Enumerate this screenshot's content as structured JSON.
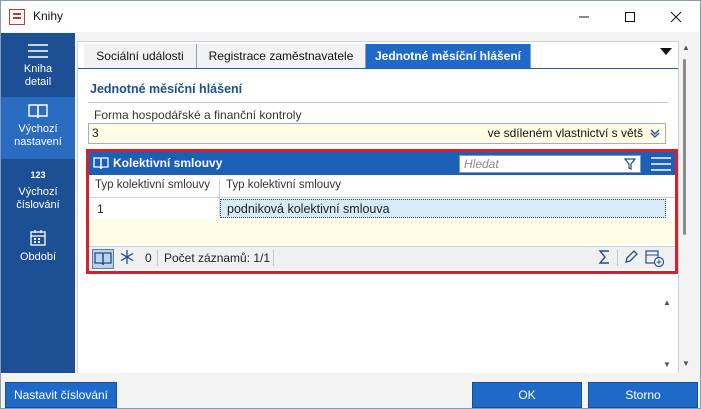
{
  "window": {
    "title": "Knihy",
    "controls": [
      "minimize",
      "maximize",
      "close"
    ]
  },
  "sidebar": {
    "items": [
      {
        "label1": "Kniha",
        "label2": "detail",
        "icon": "hamburger-icon"
      },
      {
        "label1": "Výchozí",
        "label2": "nastavení",
        "icon": "book-icon",
        "active": true
      },
      {
        "label1": "Výchozí",
        "label2": "číslování",
        "icon": "numbering-icon",
        "icon_text": "123"
      },
      {
        "label1": "Období",
        "label2": "",
        "icon": "calendar-icon"
      }
    ]
  },
  "tabs": [
    {
      "label": "Sociální události"
    },
    {
      "label": "Registrace zaměstnavatele"
    },
    {
      "label": "Jednotné měsíční hlášení",
      "active": true
    }
  ],
  "section": {
    "title": "Jednotné měsíční hlášení",
    "field_label": "Forma hospodářské a finanční kontroly",
    "field_value": "3",
    "field_display": "ve sdíleném vlastnictví s větš"
  },
  "grid": {
    "title": "Kolektivní smlouvy",
    "search_placeholder": "Hledat",
    "columns": [
      "Typ kolektivní smlouvy",
      "Typ kolektivní smlouvy"
    ],
    "rows": [
      {
        "code": "1",
        "name": "podniková kolektivní smlouva"
      }
    ],
    "footer": {
      "selected_count": "0",
      "records_label": "Počet záznamů: 1/1"
    }
  },
  "buttons": {
    "numbering": "Nastavit číslování",
    "ok": "OK",
    "cancel": "Storno"
  },
  "colors": {
    "sidebar": "#1c4f93",
    "accent": "#1f6ac8",
    "highlight_border": "#d3212d",
    "field_bg": "#fffde6"
  }
}
